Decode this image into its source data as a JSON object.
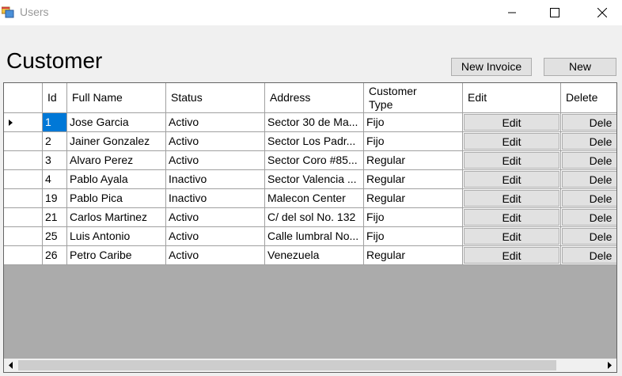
{
  "window": {
    "title": "Users",
    "icon": "app-window-icon",
    "controls": [
      "minimize-icon",
      "maximize-icon",
      "close-icon"
    ]
  },
  "page_title": "Customer",
  "toolbar": {
    "new_invoice_label": "New Invoice",
    "new_label": "New"
  },
  "grid": {
    "columns": [
      {
        "key": "id",
        "label": "Id"
      },
      {
        "key": "full_name",
        "label": "Full Name"
      },
      {
        "key": "status",
        "label": "Status"
      },
      {
        "key": "address",
        "label": "Address"
      },
      {
        "key": "customer_type",
        "label": "Customer Type"
      },
      {
        "key": "edit",
        "label": "Edit"
      },
      {
        "key": "delete",
        "label": "Delete"
      }
    ],
    "edit_button_label": "Edit",
    "delete_button_label": "Dele",
    "current_row_index": 0,
    "selected_cell": "id",
    "rows": [
      {
        "id": "1",
        "full_name": "Jose Garcia",
        "status": "Activo",
        "address": "Sector 30 de Ma...",
        "customer_type": "Fijo"
      },
      {
        "id": "2",
        "full_name": "Jainer Gonzalez",
        "status": "Activo",
        "address": "Sector Los Padr...",
        "customer_type": "Fijo"
      },
      {
        "id": "3",
        "full_name": "Alvaro Perez",
        "status": "Activo",
        "address": "Sector Coro #85...",
        "customer_type": "Regular"
      },
      {
        "id": "4",
        "full_name": "Pablo Ayala",
        "status": "Inactivo",
        "address": "Sector Valencia ...",
        "customer_type": "Regular"
      },
      {
        "id": "19",
        "full_name": "Pablo Pica",
        "status": "Inactivo",
        "address": "Malecon Center",
        "customer_type": "Regular"
      },
      {
        "id": "21",
        "full_name": "Carlos Martinez",
        "status": "Activo",
        "address": "C/ del sol No. 132",
        "customer_type": "Fijo"
      },
      {
        "id": "25",
        "full_name": "Luis Antonio",
        "status": "Activo",
        "address": "Calle lumbral No...",
        "customer_type": "Fijo"
      },
      {
        "id": "26",
        "full_name": "Petro Caribe",
        "status": "Activo",
        "address": "Venezuela",
        "customer_type": "Regular"
      }
    ]
  },
  "scrollbar": {
    "left_icon": "scroll-left-arrow-icon",
    "right_icon": "scroll-right-arrow-icon"
  },
  "colors": {
    "selection": "#0078d7",
    "grid_background": "#ababab",
    "window_background": "#f0f0f0"
  }
}
